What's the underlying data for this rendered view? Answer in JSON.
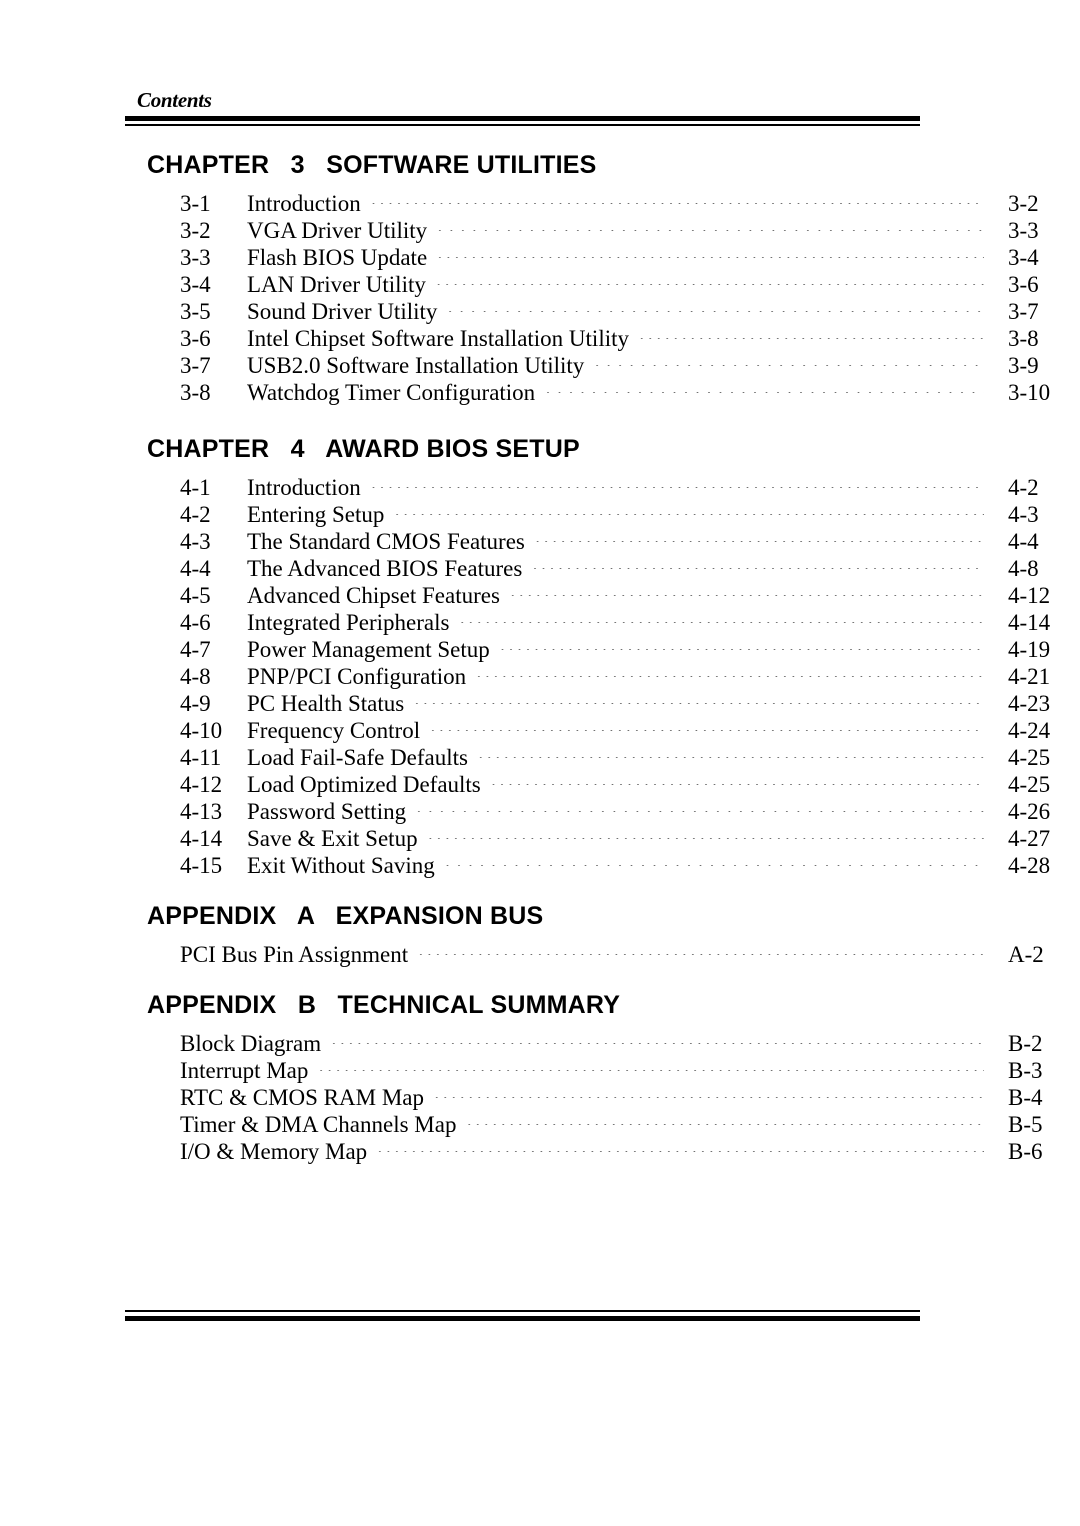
{
  "header": {
    "running_head": "Contents"
  },
  "sections": [
    {
      "heading": "CHAPTER   3   SOFTWARE UTILITIES",
      "has_numbers": true,
      "entries": [
        {
          "num": "3-1",
          "title": "Introduction",
          "page": "3-2",
          "leader": "tight"
        },
        {
          "num": "3-2",
          "title": "VGA Driver Utility",
          "page": "3-3",
          "leader": "wide"
        },
        {
          "num": "3-3",
          "title": "Flash BIOS Update",
          "page": "3-4",
          "leader": "tight"
        },
        {
          "num": "3-4",
          "title": "LAN Driver Utility",
          "page": "3-6",
          "leader": "tight"
        },
        {
          "num": "3-5",
          "title": "Sound Driver Utility",
          "page": "3-7",
          "leader": "wide"
        },
        {
          "num": "3-6",
          "title": "Intel Chipset Software Installation Utility",
          "page": "3-8",
          "leader": "tight"
        },
        {
          "num": "3-7",
          "title": "USB2.0 Software Installation Utility",
          "page": "3-9",
          "leader": "wide"
        },
        {
          "num": "3-8",
          "title": "Watchdog Timer Configuration",
          "page": "3-10",
          "leader": "wide"
        }
      ]
    },
    {
      "heading": "CHAPTER   4   AWARD BIOS SETUP",
      "has_numbers": true,
      "entries": [
        {
          "num": "4-1",
          "title": "Introduction",
          "page": "4-2",
          "leader": "tight"
        },
        {
          "num": "4-2",
          "title": "Entering Setup",
          "page": "4-3",
          "leader": "tight"
        },
        {
          "num": "4-3",
          "title": "The Standard CMOS Features",
          "page": "4-4",
          "leader": "tight"
        },
        {
          "num": "4-4",
          "title": "The Advanced BIOS Features",
          "page": "4-8",
          "leader": "tight"
        },
        {
          "num": "4-5",
          "title": "Advanced Chipset Features",
          "page": "4-12",
          "leader": "tight"
        },
        {
          "num": "4-6",
          "title": "Integrated Peripherals",
          "page": "4-14",
          "leader": "tight"
        },
        {
          "num": "4-7",
          "title": "Power Management Setup",
          "page": "4-19",
          "leader": "tight"
        },
        {
          "num": "4-8",
          "title": "PNP/PCI Configuration",
          "page": "4-21",
          "leader": "tight"
        },
        {
          "num": "4-9",
          "title": "PC Health Status",
          "page": "4-23",
          "leader": "tight"
        },
        {
          "num": "4-10",
          "title": "Frequency Control",
          "page": "4-24",
          "leader": "tight"
        },
        {
          "num": "4-11",
          "title": "Load Fail-Safe Defaults",
          "page": "4-25",
          "leader": "tight"
        },
        {
          "num": "4-12",
          "title": "Load Optimized Defaults",
          "page": "4-25",
          "leader": "tight"
        },
        {
          "num": "4-13",
          "title": "Password Setting",
          "page": "4-26",
          "leader": "wide"
        },
        {
          "num": "4-14",
          "title": "Save & Exit Setup",
          "page": "4-27",
          "leader": "tight"
        },
        {
          "num": "4-15",
          "title": "Exit Without Saving",
          "page": "4-28",
          "leader": "wide"
        }
      ]
    },
    {
      "heading": "APPENDIX   A   EXPANSION BUS",
      "has_numbers": false,
      "entries": [
        {
          "num": "",
          "title": "PCI Bus Pin Assignment",
          "page": "A-2",
          "leader": "tight"
        }
      ]
    },
    {
      "heading": "APPENDIX   B   TECHNICAL SUMMARY",
      "has_numbers": false,
      "entries": [
        {
          "num": "",
          "title": "Block Diagram",
          "page": "B-2",
          "leader": "tight"
        },
        {
          "num": "",
          "title": "Interrupt Map",
          "page": "B-3",
          "leader": "tight"
        },
        {
          "num": "",
          "title": "RTC & CMOS RAM Map",
          "page": "B-4",
          "leader": "tight"
        },
        {
          "num": "",
          "title": "Timer & DMA Channels Map",
          "page": "B-5",
          "leader": "tight"
        },
        {
          "num": "",
          "title": "I/O & Memory Map",
          "page": "B-6",
          "leader": "tight"
        }
      ]
    }
  ],
  "leader_dots": "......................................................................................................................."
}
